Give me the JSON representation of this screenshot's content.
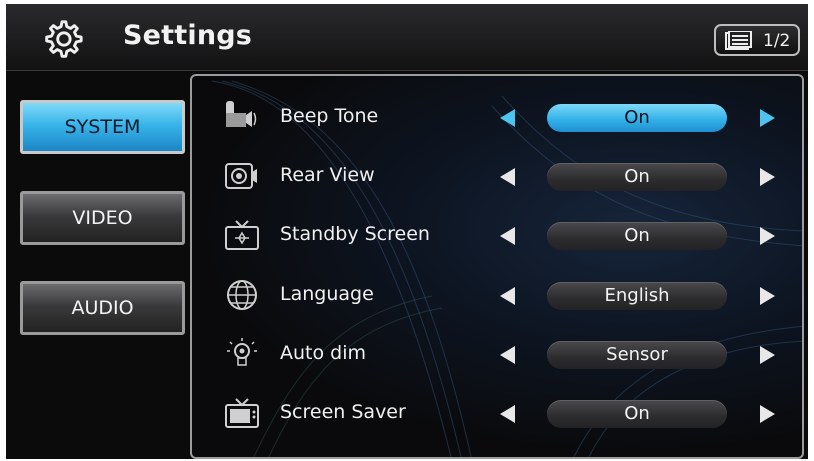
{
  "header": {
    "title": "Settings",
    "page_indicator": "1/2",
    "icons": [
      "gear-icon",
      "page-list-icon"
    ]
  },
  "sidebar": {
    "items": [
      {
        "label": "SYSTEM",
        "active": true
      },
      {
        "label": "VIDEO",
        "active": false
      },
      {
        "label": "AUDIO",
        "active": false
      }
    ]
  },
  "settings": {
    "rows": [
      {
        "label": "Beep Tone",
        "value": "On",
        "icon": "speaker-beep-icon",
        "selected": true
      },
      {
        "label": "Rear View",
        "value": "On",
        "icon": "rear-camera-icon",
        "selected": false
      },
      {
        "label": "Standby Screen",
        "value": "On",
        "icon": "tv-standby-icon",
        "selected": false
      },
      {
        "label": "Language",
        "value": "English",
        "icon": "globe-icon",
        "selected": false
      },
      {
        "label": "Auto dim",
        "value": "Sensor",
        "icon": "bulb-dim-icon",
        "selected": false
      },
      {
        "label": "Screen Saver",
        "value": "On",
        "icon": "tv-screensaver-icon",
        "selected": false
      }
    ]
  },
  "colors": {
    "accent": "#39b4ea",
    "arrow_highlight": "#4fc3f0",
    "background": "#0b0b0c"
  }
}
